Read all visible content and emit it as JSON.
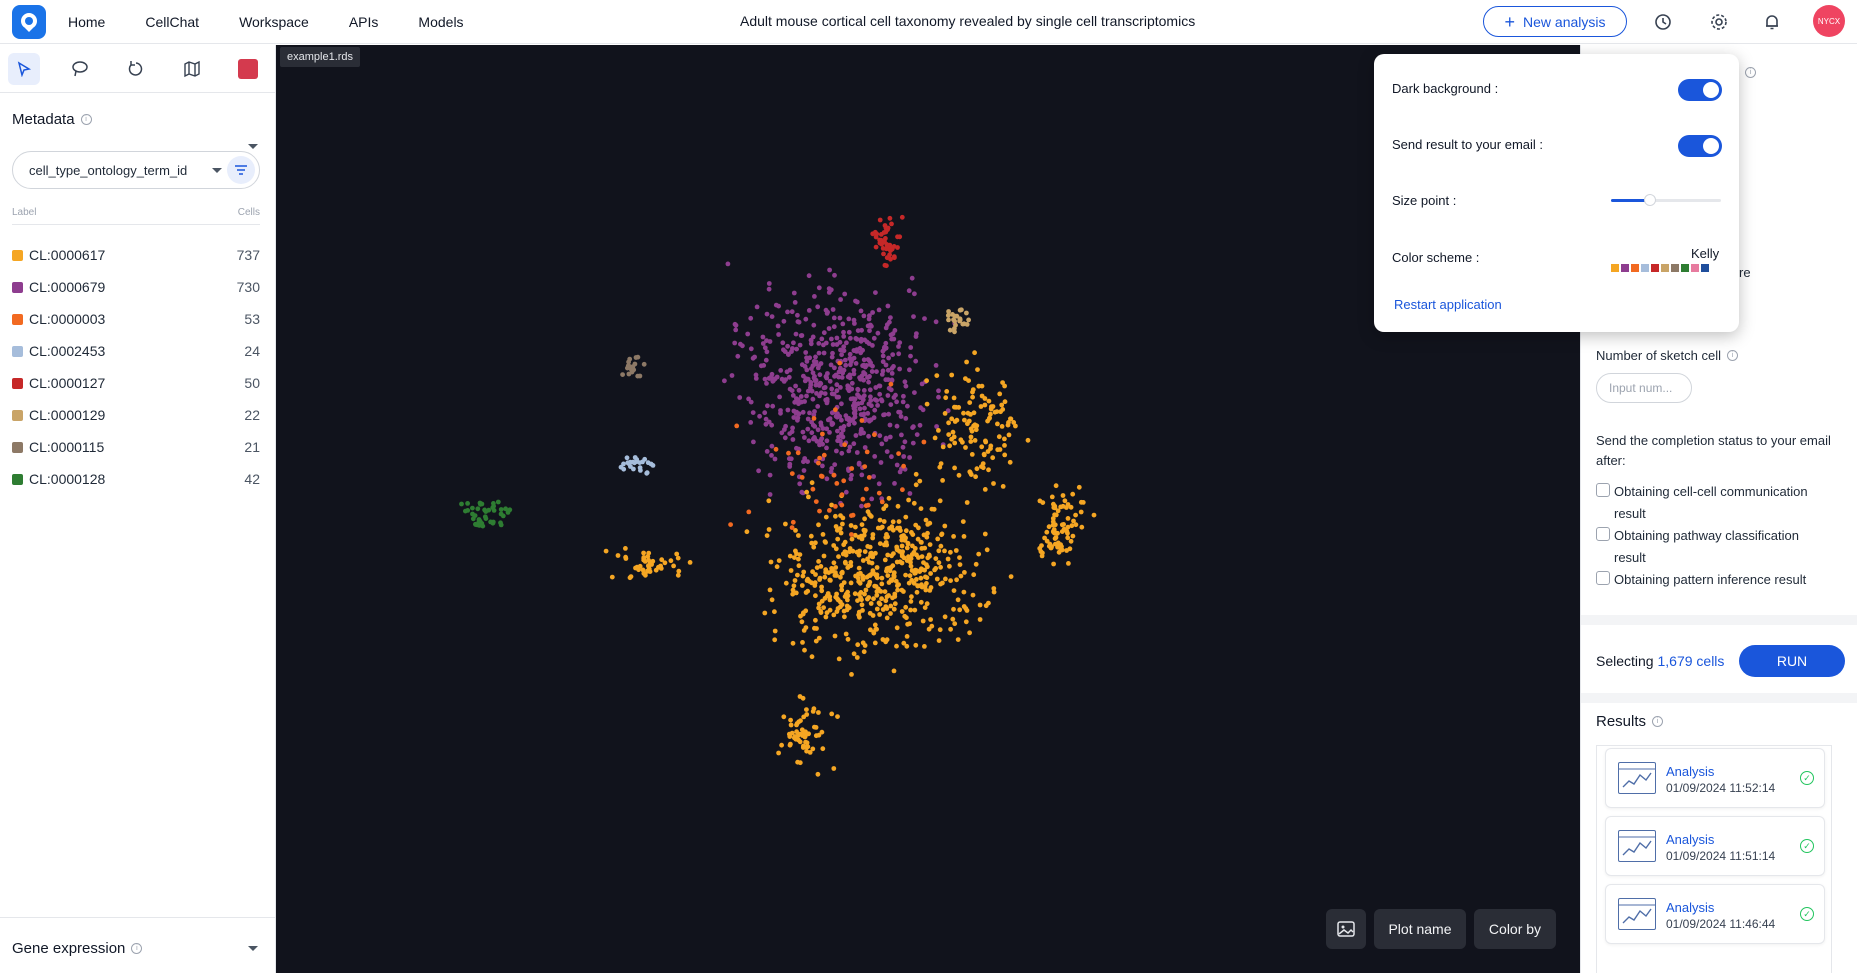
{
  "nav": {
    "logo_icon": "app-logo-icon",
    "items": [
      "Home",
      "CellChat",
      "Workspace",
      "APIs",
      "Models"
    ],
    "page_title": "Adult mouse cortical cell taxonomy revealed by single cell transcriptomics",
    "new_analysis_label": "New analysis",
    "icons": [
      "history-icon",
      "gear-icon",
      "bell-icon"
    ],
    "avatar_text": "NYCX"
  },
  "toolbar": {
    "icons": [
      "pointer-icon",
      "lasso-icon",
      "reset-icon",
      "map-icon"
    ],
    "selected_color": "#d43a4e"
  },
  "metadata": {
    "title": "Metadata",
    "select_value": "cell_type_ontology_term_id",
    "col_label": "Label",
    "col_cells": "Cells",
    "items": [
      {
        "label": "CL:0000617",
        "count": "737",
        "color": "#f5a623"
      },
      {
        "label": "CL:0000679",
        "count": "730",
        "color": "#8e3d8f"
      },
      {
        "label": "CL:0000003",
        "count": "53",
        "color": "#f26a21"
      },
      {
        "label": "CL:0002453",
        "count": "24",
        "color": "#a6bddb"
      },
      {
        "label": "CL:0000127",
        "count": "50",
        "color": "#c62828"
      },
      {
        "label": "CL:0000129",
        "count": "22",
        "color": "#c9a467"
      },
      {
        "label": "CL:0000115",
        "count": "21",
        "color": "#8d7966"
      },
      {
        "label": "CL:0000128",
        "count": "42",
        "color": "#2e7d32"
      }
    ]
  },
  "gene_expression": {
    "title": "Gene expression"
  },
  "canvas": {
    "file_tag": "example1.rds",
    "background": "#11131c",
    "buttons": {
      "image_icon": "image-icon",
      "plot_name": "Plot name",
      "color_by": "Color by"
    }
  },
  "settings": {
    "dark_background_label": "Dark background :",
    "dark_background_on": true,
    "send_email_label": "Send result to your email :",
    "send_email_on": true,
    "size_point_label": "Size point :",
    "size_point_level": 0.35,
    "color_scheme_label": "Color scheme :",
    "color_scheme_name": "Kelly",
    "scheme_colors": [
      "#f5a623",
      "#8e3d8f",
      "#f26a21",
      "#a6bddb",
      "#c62828",
      "#c9a467",
      "#8d7966",
      "#2e7d32",
      "#e77b9f",
      "#1f4e9c"
    ],
    "restart_label": "Restart application"
  },
  "right_panel": {
    "partial_re": "re",
    "sketch_label": "Number of sketch cell",
    "sketch_placeholder": "Input num...",
    "completion_label": "Send the completion status to your email after:",
    "checks": [
      {
        "label": "Obtaining cell-cell communication result",
        "checked": false
      },
      {
        "label": "Obtaining pathway classification result",
        "checked": false
      },
      {
        "label": "Obtaining pattern inference result",
        "checked": false
      }
    ],
    "selecting_prefix": "Selecting",
    "selecting_count": "1,679 cells",
    "run_label": "RUN",
    "results_title": "Results",
    "results": [
      {
        "title": "Analysis",
        "time": "01/09/2024 11:52:14",
        "status": "done"
      },
      {
        "title": "Analysis",
        "time": "01/09/2024 11:51:14",
        "status": "done"
      },
      {
        "title": "Analysis",
        "time": "01/09/2024 11:46:44",
        "status": "done"
      }
    ]
  }
}
